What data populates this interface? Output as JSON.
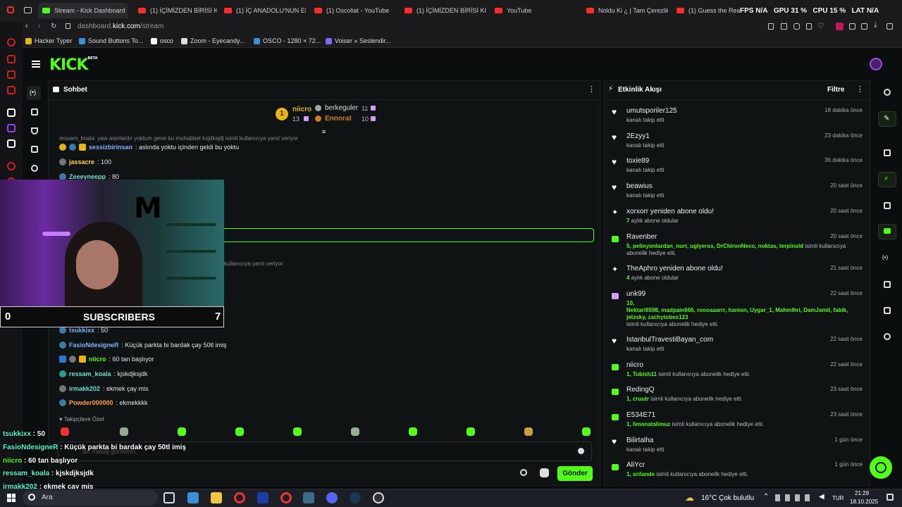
{
  "browser": {
    "tabs": [
      {
        "label": "Stream - Kick Dashboard",
        "icon": "kick-icon",
        "active": true
      },
      {
        "label": "(1) İÇİMİZDEN BİRİSİ KÖS",
        "icon": "youtube-icon"
      },
      {
        "label": "(1) İÇ ANADOLU'NUN EN",
        "icon": "youtube-icon"
      },
      {
        "label": "(1) Oscoliat - YouTube",
        "icon": "youtube-icon"
      },
      {
        "label": "(1) İÇİMİZDEN BİRİSİ KÖS",
        "icon": "youtube-icon"
      },
      {
        "label": "YouTube",
        "icon": "youtube-icon"
      },
      {
        "label": "Noldu Ki ¿ | Tam Çerezlik",
        "icon": "youtube-icon"
      },
      {
        "label": "(1) Guess the Real vs A",
        "icon": "youtube-icon"
      }
    ],
    "url_prefix": "dashboard.",
    "url_domain": "kick.com",
    "url_path": "/stream",
    "bookmarks": [
      "Hacker Typer",
      "Sound Buttons To...",
      "osco",
      "Zoom - Eyecandy...",
      "OSCO - 1280 × 72...",
      "Voiser » Seslendir..."
    ]
  },
  "perf": {
    "fps_label": "FPS",
    "fps_value": "N/A",
    "gpu_label": "GPU",
    "gpu_value": "31 %",
    "cpu_label": "CPU",
    "cpu_value": "15 %",
    "lat_label": "LAT",
    "lat_value": "N/A"
  },
  "kick": {
    "logo": "KICK",
    "logo_sup": "BETA"
  },
  "chat": {
    "title": "Sohbet",
    "leaders": [
      {
        "rank": "1",
        "name": "niicro",
        "value": "13"
      },
      {
        "rank": "",
        "name": "berkeguler",
        "value": "11"
      },
      {
        "rank": "",
        "name": "Ennorat",
        "value": "10"
      }
    ],
    "reply_context_1": "ressam_koala: yaw asiırlardır yoktum gene bu muhabbet ksjdksjdj isimli kullanıcıya yanıt veriyor",
    "reply_context_2": "kullanıcıya yanıt veriyor",
    "messages": [
      {
        "name": "sessizbirinsan",
        "text": ": aslında yoktu içinden geldi bu yoktu",
        "color": "#7fb0ff"
      },
      {
        "name": "jassacre",
        "text": ": 100",
        "color": "#ffd54a"
      },
      {
        "name": "Zeeeyneepp",
        "text": ": 80",
        "color": "#6de0d2"
      },
      {
        "name": "tsukkixx",
        "text": ": 50",
        "color": "#7fb0ff"
      },
      {
        "name": "FasioNdesigneR",
        "text": ": Küçük parkta bi bardak çay 50tl imiş",
        "color": "#7fb0ff"
      },
      {
        "name": "niicro",
        "text": ": 60 tan başlıyor",
        "color": "#53fc18"
      },
      {
        "name": "ressam_koala",
        "text": ": kjskdjksjdk",
        "color": "#6de0d2"
      },
      {
        "name": "irmakk202",
        "text": ": ekmek çay mis",
        "color": "#6de0d2"
      },
      {
        "name": "Powder000000",
        "text": ": ekmekkkk",
        "color": "#ff9f40"
      }
    ],
    "partial_name": "ress",
    "subscribers_only": "Takipçilere Özel",
    "input_placeholder": "Bir mesaj gönderin",
    "send_label": "Gönder"
  },
  "activity": {
    "title": "Etkinlik Akışı",
    "filter_label": "Filtre",
    "events": [
      {
        "icon": "heart-icon",
        "title": "umutsporiler125",
        "time": "18 dakika önce",
        "sub": "kanalı takip etti"
      },
      {
        "icon": "heart-icon",
        "title": "2Ezyy1",
        "time": "23 dakika önce",
        "sub": "kanalı takip etti"
      },
      {
        "icon": "heart-icon",
        "title": "toxie89",
        "time": "36 dakika önce",
        "sub": "kanalı takip etti"
      },
      {
        "icon": "heart-icon",
        "title": "beawius",
        "time": "20 saat önce",
        "sub": "kanalı takip etti"
      },
      {
        "icon": "sparkle-icon",
        "title": "xorxorr yeniden abone oldu!",
        "time": "20 saat önce",
        "sub_hl": "7",
        "sub": " aylık abone oldular"
      },
      {
        "icon": "gift-icon",
        "title": "Ravenber",
        "time": "20 saat önce",
        "sub_hl": "5, pelinyonlardan_nurr, uglyeros, DrChironNeco, noktas, terpinold",
        "sub": " isimli kullanıcıya",
        "sub2": "abonelik hediye etti."
      },
      {
        "icon": "sparkle-icon",
        "title": "TheAphro yeniden abone oldu!",
        "time": "21 saat önce",
        "sub_hl": "4",
        "sub": " aylık abone oldular"
      },
      {
        "icon": "gift-icon",
        "title": "unk99",
        "time": "22 saat önce",
        "sub_hl": "10,",
        "sub_hl2": "Nektari6598, madpain666, roooaaarrr, hanion, Uygar_1, Mahmlhri, DamJamil, fabik,",
        "sub_hl3": "jetzsky, zachytobes123",
        "sub3": "isimli kullanıcıya abonelik hediye etti."
      },
      {
        "icon": "heart-icon",
        "title": "IstanbulTravestiBayan_com",
        "time": "22 saat önce",
        "sub": "kanalı takip etti"
      },
      {
        "icon": "gift-icon",
        "title": "niicro",
        "time": "22 saat önce",
        "sub_hl": "1, Tubish11",
        "sub": " isimli kullanıcıya abonelik hediye etti."
      },
      {
        "icon": "gift-icon",
        "title": "RedingQ",
        "time": "23 saat önce",
        "sub_hl": "1, cruutr",
        "sub": " isimli kullanıcıya abonelik hediye etti."
      },
      {
        "icon": "gift-icon",
        "title": "E534E71",
        "time": "23 saat önce",
        "sub_hl": "1, limonatalimuz",
        "sub": " isimli kullanıcıya abonelik hediye etti."
      },
      {
        "icon": "heart-icon",
        "title": "Bilirtalha",
        "time": "1 gün önce",
        "sub": "kanalı takip etti"
      },
      {
        "icon": "gift-icon",
        "title": "AliYcr",
        "time": "1 gün önce",
        "sub_hl": "1, orilande",
        "sub": " isimli kullanıcıya abonelik hediye etti."
      }
    ]
  },
  "stream_overlay": {
    "subs_left": "0",
    "subs_label": "SUBSCRIBERS",
    "subs_right": "7",
    "monster_text": "M",
    "chat": [
      {
        "name": "tsukkixx",
        "text": " : 50"
      },
      {
        "name": "FasioNdesigneR",
        "text": " : Küçük parkta bi bardak çay 50tl imiş"
      },
      {
        "name": "niicro",
        "text": " : 60 tan başlıyor"
      },
      {
        "name": "ressam_koala",
        "text": " : kjskdjksjdk"
      },
      {
        "name": "irmakk202",
        "text": " : ekmek çay mis"
      }
    ]
  },
  "taskbar": {
    "search_label": "Ara",
    "weather": "16°C",
    "weather_desc": "Çok bulutlu",
    "lang": "TUR",
    "time": "21:29",
    "date": "18.10.2025"
  }
}
